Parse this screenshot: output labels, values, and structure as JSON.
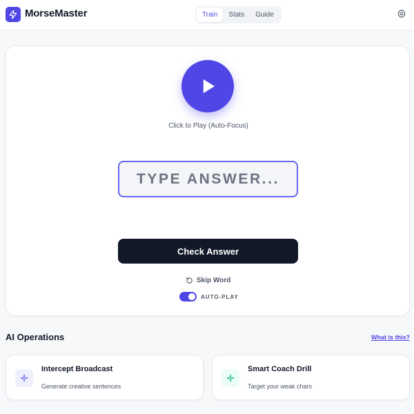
{
  "app": {
    "title": "MorseMaster",
    "accent_color": "#4f46e5",
    "logo_icon": "lightning-icon"
  },
  "nav": {
    "tabs": [
      {
        "label": "Train",
        "active": true
      },
      {
        "label": "Stats",
        "active": false
      },
      {
        "label": "Guide",
        "active": false
      }
    ],
    "settings_icon": "gear-icon"
  },
  "trainer": {
    "play_icon": "play-icon",
    "play_caption": "Click to Play (Auto-Focus)",
    "answer_placeholder": "TYPE ANSWER...",
    "check_label": "Check Answer",
    "skip_label": "Skip Word",
    "skip_icon": "rotate-ccw-icon",
    "autoplay_label": "AUTO-PLAY",
    "autoplay_on": true
  },
  "ai_operations": {
    "title": "AI Operations",
    "help_link": "What is this?",
    "cards": [
      {
        "title": "Intercept Broadcast",
        "description": "Generate creative sentences",
        "icon": "sparkle-icon",
        "icon_color": "#6366f1",
        "icon_bg": "#eef0fe"
      },
      {
        "title": "Smart Coach Drill",
        "description": "Target your weak chars",
        "icon": "sparkle-icon",
        "icon_color": "#10b981",
        "icon_bg": "#ecfdf5"
      }
    ]
  }
}
